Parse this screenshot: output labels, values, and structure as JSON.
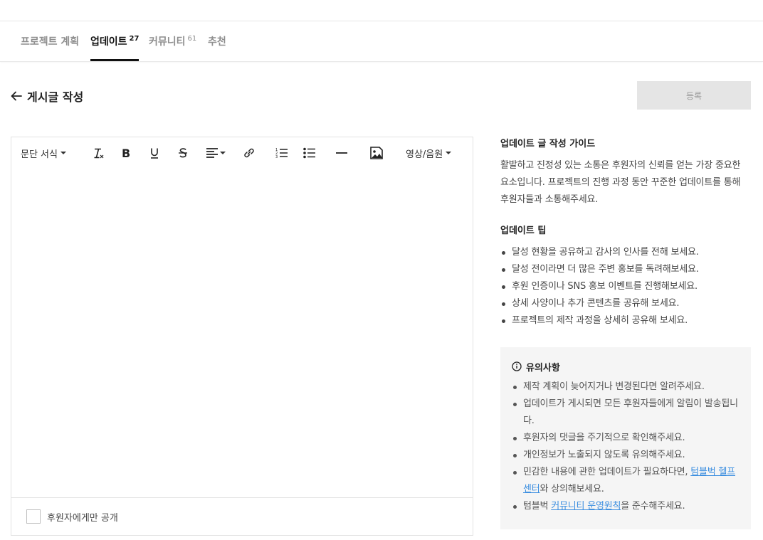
{
  "tabs": [
    {
      "label": "프로젝트 계획",
      "count": ""
    },
    {
      "label": "업데이트",
      "count": "27",
      "active": true
    },
    {
      "label": "커뮤니티",
      "count": "61"
    },
    {
      "label": "추천",
      "count": ""
    }
  ],
  "page": {
    "back_title": "게시글 작성",
    "submit_label": "등록"
  },
  "toolbar": {
    "paragraph_format": "문단 서식",
    "media": "영상/음원",
    "icons": [
      "clear-format-icon",
      "bold-icon",
      "underline-icon",
      "strikethrough-icon",
      "align-icon",
      "link-icon",
      "ordered-list-icon",
      "unordered-list-icon",
      "horizontal-rule-icon",
      "image-icon"
    ]
  },
  "editor": {
    "backer_only_label": "후원자에게만 공개"
  },
  "guide": {
    "title": "업데이트 글 작성 가이드",
    "body": "활발하고 진정성 있는 소통은 후원자의 신뢰를 얻는 가장 중요한 요소입니다. 프로젝트의 진행 과정 동안 꾸준한 업데이트를 통해 후원자들과 소통해주세요.",
    "tips_title": "업데이트 팁",
    "tips": [
      "달성 현황을 공유하고 감사의 인사를 전해 보세요.",
      "달성 전이라면 더 많은 주변 홍보를 독려해보세요.",
      "후원 인증이나 SNS 홍보 이벤트를 진행해보세요.",
      "상세 사양이나 추가 콘텐츠를 공유해 보세요.",
      "프로젝트의 제작 과정을 상세히 공유해 보세요."
    ]
  },
  "notice": {
    "title": "유의사항",
    "items": [
      "제작 계획이 늦어지거나 변경된다면 알려주세요.",
      "업데이트가 게시되면 모든 후원자들에게 알림이 발송됩니다.",
      "후원자의 댓글을 주기적으로 확인해주세요.",
      "개인정보가 노출되지 않도록 유의해주세요."
    ],
    "help_item": {
      "before": "민감한 내용에 관한 업데이트가 필요하다면, ",
      "link": "텀블벅 헬프센터",
      "after": "와 상의해보세요."
    },
    "policy_item": {
      "before": "텀블벅 ",
      "link": "커뮤니티 운영원칙",
      "after": "을 준수해주세요."
    }
  },
  "colors": {
    "link": "#3b8ee0",
    "button_disabled_bg": "#e5e5e5",
    "notice_bg": "#f5f5f5"
  }
}
